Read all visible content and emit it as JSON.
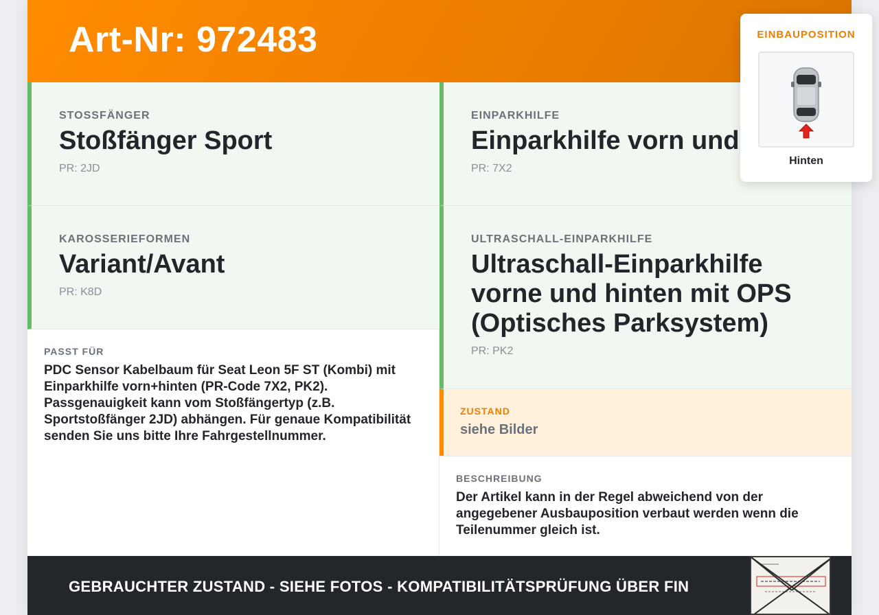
{
  "header": {
    "art_nr": "Art-Nr: 972483"
  },
  "cells": {
    "stossfaenger": {
      "label": "STOSSFÄNGER",
      "title": "Stoßfänger Sport",
      "pr": "PR: 2JD"
    },
    "einparkhilfe": {
      "label": "EINPARKHILFE",
      "title": "Einparkhilfe vorn und hinten",
      "pr": "PR: 7X2"
    },
    "karosserie": {
      "label": "KAROSSERIEFORMEN",
      "title": "Variant/Avant",
      "pr": "PR: K8D"
    },
    "ultraschall": {
      "label": "ULTRASCHALL-EINPARKHILFE",
      "title": "Ultraschall-Einparkhilfe vorne und hinten mit OPS (Optisches Parksystem)",
      "pr": "PR: PK2"
    }
  },
  "fits": {
    "label": "PASST FÜR",
    "text": "PDC Sensor Kabelbaum für Seat Leon 5F ST (Kombi) mit Einparkhilfe vorn+hinten (PR-Code 7X2, PK2). Passgenauigkeit kann vom Stoßfängertyp (z.B. Sportstoßfänger 2JD) abhängen. Für genaue Kompatibilität senden Sie uns bitte Ihre Fahrgestellnummer."
  },
  "zustand": {
    "label": "ZUSTAND",
    "value": "siehe Bilder"
  },
  "beschreibung": {
    "label": "BESCHREIBUNG",
    "text": "Der Artikel kann in der Regel abweichend von der angegebener Ausbauposition verbaut werden wenn die Teilenummer gleich ist."
  },
  "footer": {
    "text": "GEBRAUCHTER ZUSTAND - SIEHE FOTOS - KOMPATIBILITÄTSPRÜFUNG ÜBER FIN"
  },
  "einbauposition": {
    "title": "EINBAUPOSITION",
    "caption": "Hinten"
  },
  "colors": {
    "brand_orange": "#ff8c00",
    "accent_green": "#66bb6a",
    "footer_dark": "#23262b"
  }
}
